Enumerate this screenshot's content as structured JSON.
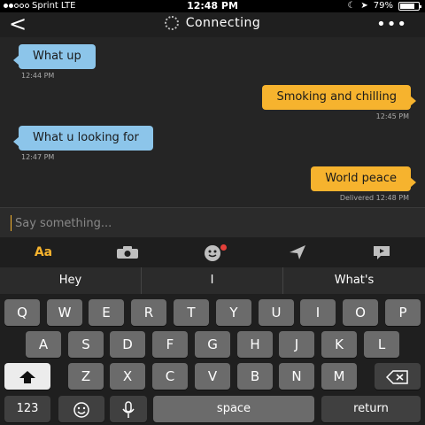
{
  "status_bar": {
    "carrier": "Sprint",
    "network": "LTE",
    "time": "12:48 PM",
    "battery_percent": "79%",
    "battery_level": 0.79,
    "icons": [
      "moon-icon",
      "location-icon",
      "battery-icon"
    ]
  },
  "nav": {
    "back_label": "<",
    "title": "Connecting",
    "more_label": "•••"
  },
  "messages": [
    {
      "direction": "in",
      "text": "What up",
      "time": "12:44 PM"
    },
    {
      "direction": "out",
      "text": "Smoking and chilling",
      "time": "12:45 PM"
    },
    {
      "direction": "in",
      "text": "What u looking for",
      "time": "12:47 PM"
    },
    {
      "direction": "out",
      "text": "World peace",
      "time": "Delivered 12:48 PM"
    }
  ],
  "compose": {
    "placeholder": "Say something..."
  },
  "toolbar": {
    "text_format_label": "Aa",
    "icons": [
      "camera-icon",
      "sticker-icon",
      "location-send-icon",
      "saved-phrases-icon"
    ]
  },
  "keyboard": {
    "suggestions": [
      "Hey",
      "I",
      "What's"
    ],
    "row1": [
      "Q",
      "W",
      "E",
      "R",
      "T",
      "Y",
      "U",
      "I",
      "O",
      "P"
    ],
    "row2": [
      "A",
      "S",
      "D",
      "F",
      "G",
      "H",
      "J",
      "K",
      "L"
    ],
    "row3": [
      "Z",
      "X",
      "C",
      "V",
      "B",
      "N",
      "M"
    ],
    "numbers_label": "123",
    "space_label": "space",
    "return_label": "return"
  },
  "colors": {
    "incoming_bubble": "#8cc5ea",
    "outgoing_bubble": "#f6b32e",
    "accent": "#f6b32e",
    "badge": "#e5403a"
  }
}
